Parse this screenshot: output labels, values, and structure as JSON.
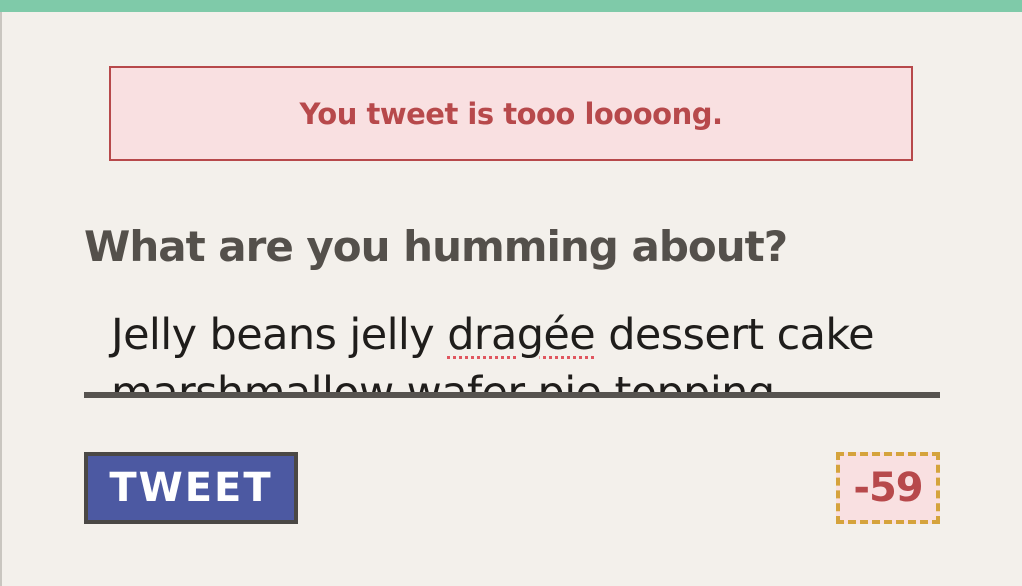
{
  "error": {
    "message": "You tweet is tooo loooong."
  },
  "compose": {
    "prompt": "What are you humming about?",
    "text_before": "Jelly beans jelly ",
    "misspelled_word": "dragée",
    "text_after": " dessert cake marshmallow wafer pie topping"
  },
  "actions": {
    "tweet_label": "TWEET"
  },
  "counter": {
    "value": "-59"
  },
  "colors": {
    "top_bar": "#7fcaa9",
    "error": "#b7494b",
    "error_bg": "#f9e0e1",
    "button": "#4c59a2",
    "counter_border": "#d5a33c"
  }
}
